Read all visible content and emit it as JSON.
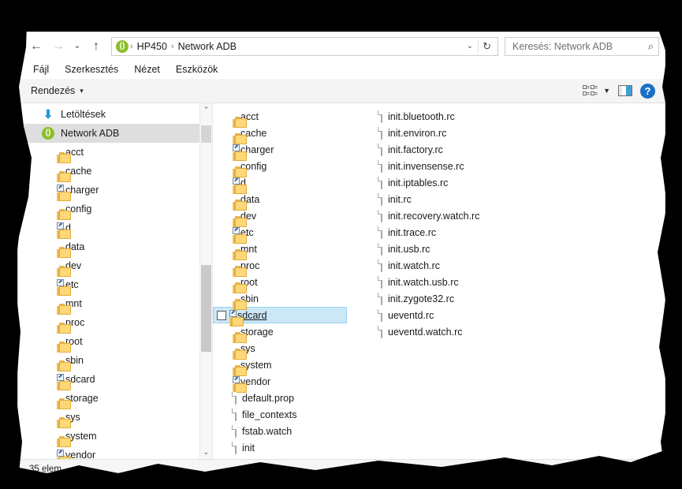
{
  "window": {
    "title": "HP450\\Network ADB",
    "title_icon": "adb-device-icon",
    "accent_green": "#8cbe2a",
    "selection_blue": "#cce8f7",
    "sidebar_selection_gray": "#dedede"
  },
  "nav": {
    "back_icon": "←",
    "forward_icon": "→",
    "recent_icon": "⌄",
    "up_icon": "↑",
    "breadcrumb": [
      "HP450",
      "Network ADB"
    ],
    "breadcrumb_sep": "›",
    "address_caret": "⌄",
    "refresh_icon": "↻"
  },
  "search": {
    "placeholder": "Keresés: Network ADB",
    "icon": "search-icon"
  },
  "menubar": {
    "items": [
      "Fájl",
      "Szerkesztés",
      "Nézet",
      "Eszközök"
    ]
  },
  "commandbar": {
    "organize_label": "Rendezés",
    "organize_caret": "▾",
    "view_layout_icon": "view-layout-icon",
    "view_caret": "▼",
    "preview_pane_icon": "preview-pane-icon",
    "help_label": "?"
  },
  "sidebar": {
    "items": [
      {
        "label": "Letöltések",
        "icon": "downloads-icon",
        "indent": false,
        "selected": false,
        "shortcut": false
      },
      {
        "label": "Network ADB",
        "icon": "adb-device-icon",
        "indent": false,
        "selected": true,
        "shortcut": false
      },
      {
        "label": "acct",
        "icon": "folder-icon",
        "indent": true,
        "selected": false,
        "shortcut": false
      },
      {
        "label": "cache",
        "icon": "folder-icon",
        "indent": true,
        "selected": false,
        "shortcut": false
      },
      {
        "label": "charger",
        "icon": "folder-icon",
        "indent": true,
        "selected": false,
        "shortcut": true
      },
      {
        "label": "config",
        "icon": "folder-icon",
        "indent": true,
        "selected": false,
        "shortcut": false
      },
      {
        "label": "d",
        "icon": "folder-icon",
        "indent": true,
        "selected": false,
        "shortcut": true
      },
      {
        "label": "data",
        "icon": "folder-icon",
        "indent": true,
        "selected": false,
        "shortcut": false
      },
      {
        "label": "dev",
        "icon": "folder-icon",
        "indent": true,
        "selected": false,
        "shortcut": false
      },
      {
        "label": "etc",
        "icon": "folder-icon",
        "indent": true,
        "selected": false,
        "shortcut": true
      },
      {
        "label": "mnt",
        "icon": "folder-icon",
        "indent": true,
        "selected": false,
        "shortcut": false
      },
      {
        "label": "proc",
        "icon": "folder-icon",
        "indent": true,
        "selected": false,
        "shortcut": false
      },
      {
        "label": "root",
        "icon": "folder-icon",
        "indent": true,
        "selected": false,
        "shortcut": false
      },
      {
        "label": "sbin",
        "icon": "folder-icon",
        "indent": true,
        "selected": false,
        "shortcut": false
      },
      {
        "label": "sdcard",
        "icon": "folder-icon",
        "indent": true,
        "selected": false,
        "shortcut": true
      },
      {
        "label": "storage",
        "icon": "folder-icon",
        "indent": true,
        "selected": false,
        "shortcut": false
      },
      {
        "label": "sys",
        "icon": "folder-icon",
        "indent": true,
        "selected": false,
        "shortcut": false
      },
      {
        "label": "system",
        "icon": "folder-icon",
        "indent": true,
        "selected": false,
        "shortcut": false
      },
      {
        "label": "vendor",
        "icon": "folder-icon",
        "indent": true,
        "selected": false,
        "shortcut": true
      }
    ],
    "scroll_up_icon": "⌃",
    "scroll_down_icon": "⌄"
  },
  "filelist": {
    "column_a": [
      {
        "label": "acct",
        "icon": "folder-icon",
        "shortcut": false,
        "hovered": false
      },
      {
        "label": "cache",
        "icon": "folder-icon",
        "shortcut": false,
        "hovered": false
      },
      {
        "label": "charger",
        "icon": "folder-icon",
        "shortcut": true,
        "hovered": false
      },
      {
        "label": "config",
        "icon": "folder-icon",
        "shortcut": false,
        "hovered": false
      },
      {
        "label": "d",
        "icon": "folder-icon",
        "shortcut": true,
        "hovered": false
      },
      {
        "label": "data",
        "icon": "folder-icon",
        "shortcut": false,
        "hovered": false
      },
      {
        "label": "dev",
        "icon": "folder-icon",
        "shortcut": false,
        "hovered": false
      },
      {
        "label": "etc",
        "icon": "folder-icon",
        "shortcut": true,
        "hovered": false
      },
      {
        "label": "mnt",
        "icon": "folder-icon",
        "shortcut": false,
        "hovered": false
      },
      {
        "label": "proc",
        "icon": "folder-icon",
        "shortcut": false,
        "hovered": false
      },
      {
        "label": "root",
        "icon": "folder-icon",
        "shortcut": false,
        "hovered": false
      },
      {
        "label": "sbin",
        "icon": "folder-icon",
        "shortcut": false,
        "hovered": false
      },
      {
        "label": "sdcard",
        "icon": "folder-icon",
        "shortcut": true,
        "hovered": true
      },
      {
        "label": "storage",
        "icon": "folder-icon",
        "shortcut": false,
        "hovered": false
      },
      {
        "label": "sys",
        "icon": "folder-icon",
        "shortcut": false,
        "hovered": false
      },
      {
        "label": "system",
        "icon": "folder-icon",
        "shortcut": false,
        "hovered": false
      },
      {
        "label": "vendor",
        "icon": "folder-icon",
        "shortcut": true,
        "hovered": false
      },
      {
        "label": "default.prop",
        "icon": "file-icon",
        "shortcut": false,
        "hovered": false
      },
      {
        "label": "file_contexts",
        "icon": "file-icon",
        "shortcut": false,
        "hovered": false
      },
      {
        "label": "fstab.watch",
        "icon": "file-icon",
        "shortcut": false,
        "hovered": false
      },
      {
        "label": "init",
        "icon": "file-icon",
        "shortcut": false,
        "hovered": false
      }
    ],
    "column_b": [
      {
        "label": "init.bluetooth.rc",
        "icon": "file-icon"
      },
      {
        "label": "init.environ.rc",
        "icon": "file-icon"
      },
      {
        "label": "init.factory.rc",
        "icon": "file-icon"
      },
      {
        "label": "init.invensense.rc",
        "icon": "file-icon"
      },
      {
        "label": "init.iptables.rc",
        "icon": "file-icon"
      },
      {
        "label": "init.rc",
        "icon": "file-icon"
      },
      {
        "label": "init.recovery.watch.rc",
        "icon": "file-icon"
      },
      {
        "label": "init.trace.rc",
        "icon": "file-icon"
      },
      {
        "label": "init.usb.rc",
        "icon": "file-icon"
      },
      {
        "label": "init.watch.rc",
        "icon": "file-icon"
      },
      {
        "label": "init.watch.usb.rc",
        "icon": "file-icon"
      },
      {
        "label": "init.zygote32.rc",
        "icon": "file-icon"
      },
      {
        "label": "ueventd.rc",
        "icon": "file-icon"
      },
      {
        "label": "ueventd.watch.rc",
        "icon": "file-icon"
      }
    ]
  },
  "statusbar": {
    "item_count": "35 elem",
    "details_view_icon": "details-view-icon",
    "icons_view_icon": "large-icons-view-icon"
  }
}
